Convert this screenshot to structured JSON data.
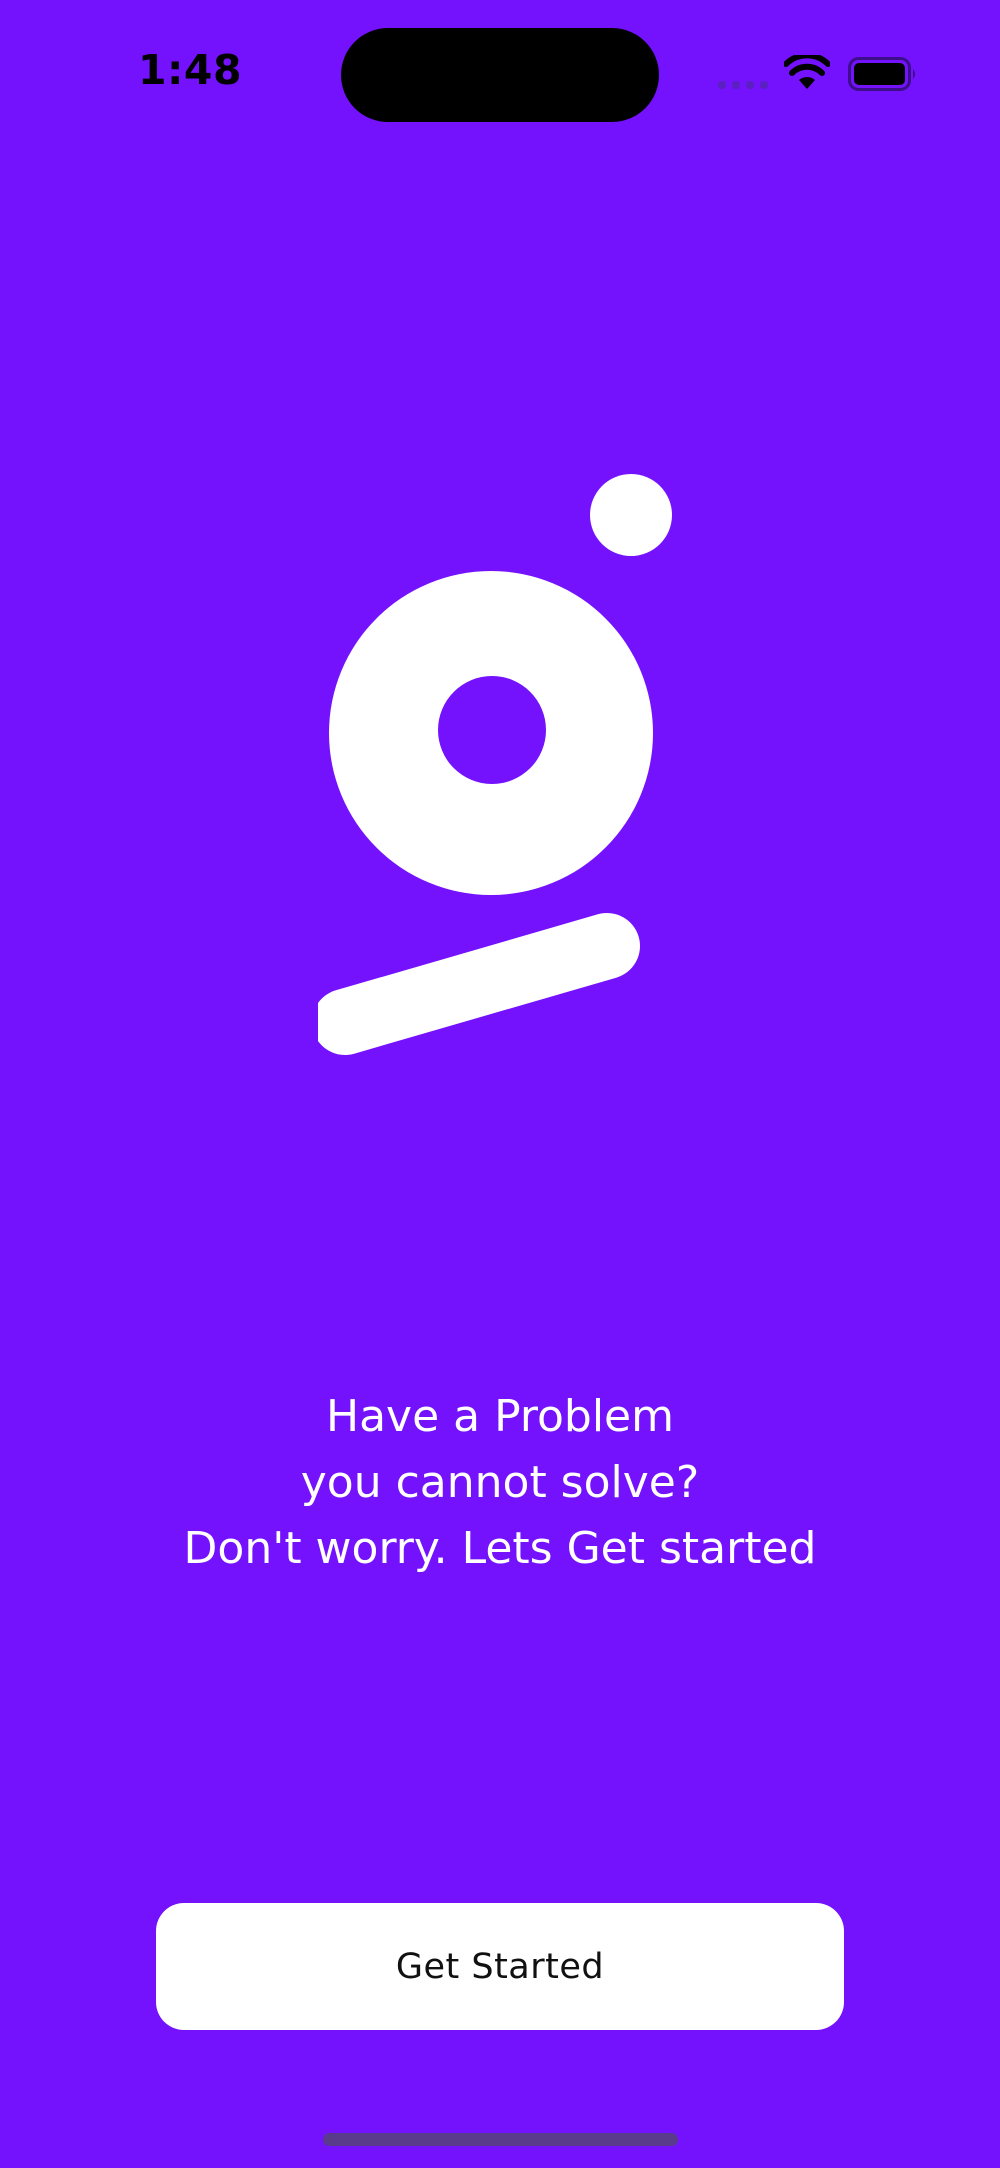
{
  "status_bar": {
    "time": "1:48"
  },
  "onboarding": {
    "message_lines": [
      "Have a Problem",
      "you cannot solve?",
      "Don't worry. Lets Get started"
    ],
    "cta_label": "Get Started"
  },
  "colors": {
    "background": "#7412FE",
    "logo": "#FFFFFF",
    "button_background": "#FFFFFF",
    "button_text": "#111111"
  },
  "icons": [
    "signal-icon",
    "wifi-icon",
    "battery-icon",
    "app-logo"
  ]
}
